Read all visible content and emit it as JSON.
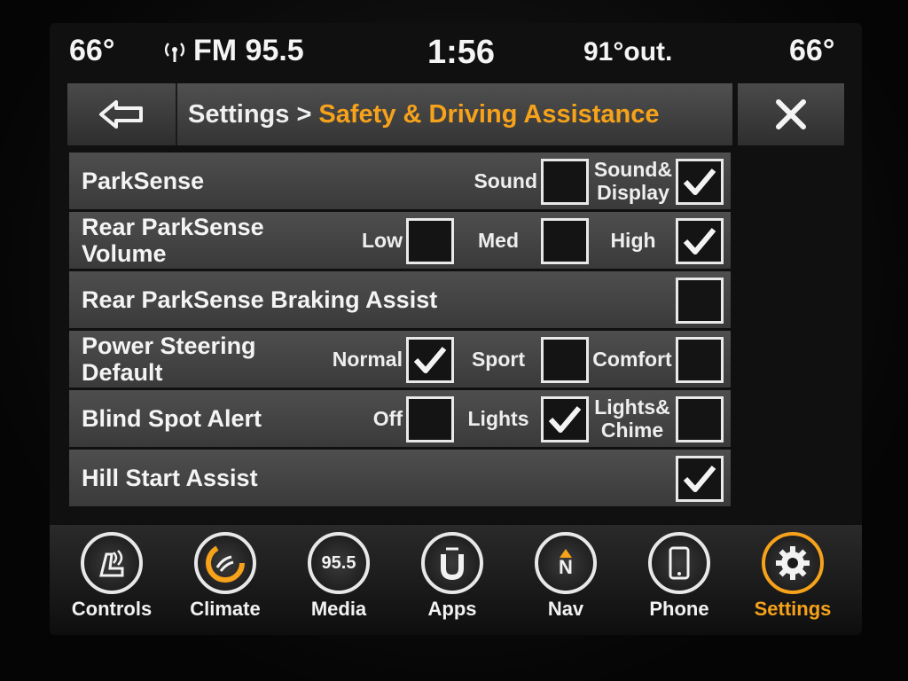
{
  "status": {
    "left_temp": "66°",
    "radio": "FM 95.5",
    "time": "1:56",
    "outside_temp": "91°out.",
    "right_temp": "66°"
  },
  "header": {
    "crumb": "Settings >",
    "current": "Safety & Driving Assistance"
  },
  "rows": [
    {
      "label": "ParkSense",
      "options": [
        {
          "label": "Sound",
          "checked": false
        },
        {
          "label": "Sound&\nDisplay",
          "checked": true
        }
      ]
    },
    {
      "label": "Rear ParkSense Volume",
      "options": [
        {
          "label": "Low",
          "checked": false
        },
        {
          "label": "Med",
          "checked": false
        },
        {
          "label": "High",
          "checked": true
        }
      ]
    },
    {
      "label": "Rear ParkSense Braking Assist",
      "options": [
        {
          "label": "",
          "checked": false
        }
      ]
    },
    {
      "label": "Power Steering Default",
      "options": [
        {
          "label": "Normal",
          "checked": true
        },
        {
          "label": "Sport",
          "checked": false
        },
        {
          "label": "Comfort",
          "checked": false
        }
      ]
    },
    {
      "label": "Blind Spot Alert",
      "options": [
        {
          "label": "Off",
          "checked": false
        },
        {
          "label": "Lights",
          "checked": true
        },
        {
          "label": "Lights&\nChime",
          "checked": false
        }
      ]
    },
    {
      "label": "Hill Start Assist",
      "options": [
        {
          "label": "",
          "checked": true
        }
      ]
    }
  ],
  "dock": [
    {
      "label": "Controls",
      "icon": "controls-icon"
    },
    {
      "label": "Climate",
      "icon": "climate-icon"
    },
    {
      "label": "Media",
      "icon": "media-icon",
      "badge": "95.5"
    },
    {
      "label": "Apps",
      "icon": "apps-icon"
    },
    {
      "label": "Nav",
      "icon": "nav-icon",
      "badge": "N"
    },
    {
      "label": "Phone",
      "icon": "phone-icon"
    },
    {
      "label": "Settings",
      "icon": "gear-icon",
      "active": true
    }
  ],
  "colors": {
    "accent": "#f6a21a",
    "text": "#f2f2f2",
    "row": "#444444"
  }
}
